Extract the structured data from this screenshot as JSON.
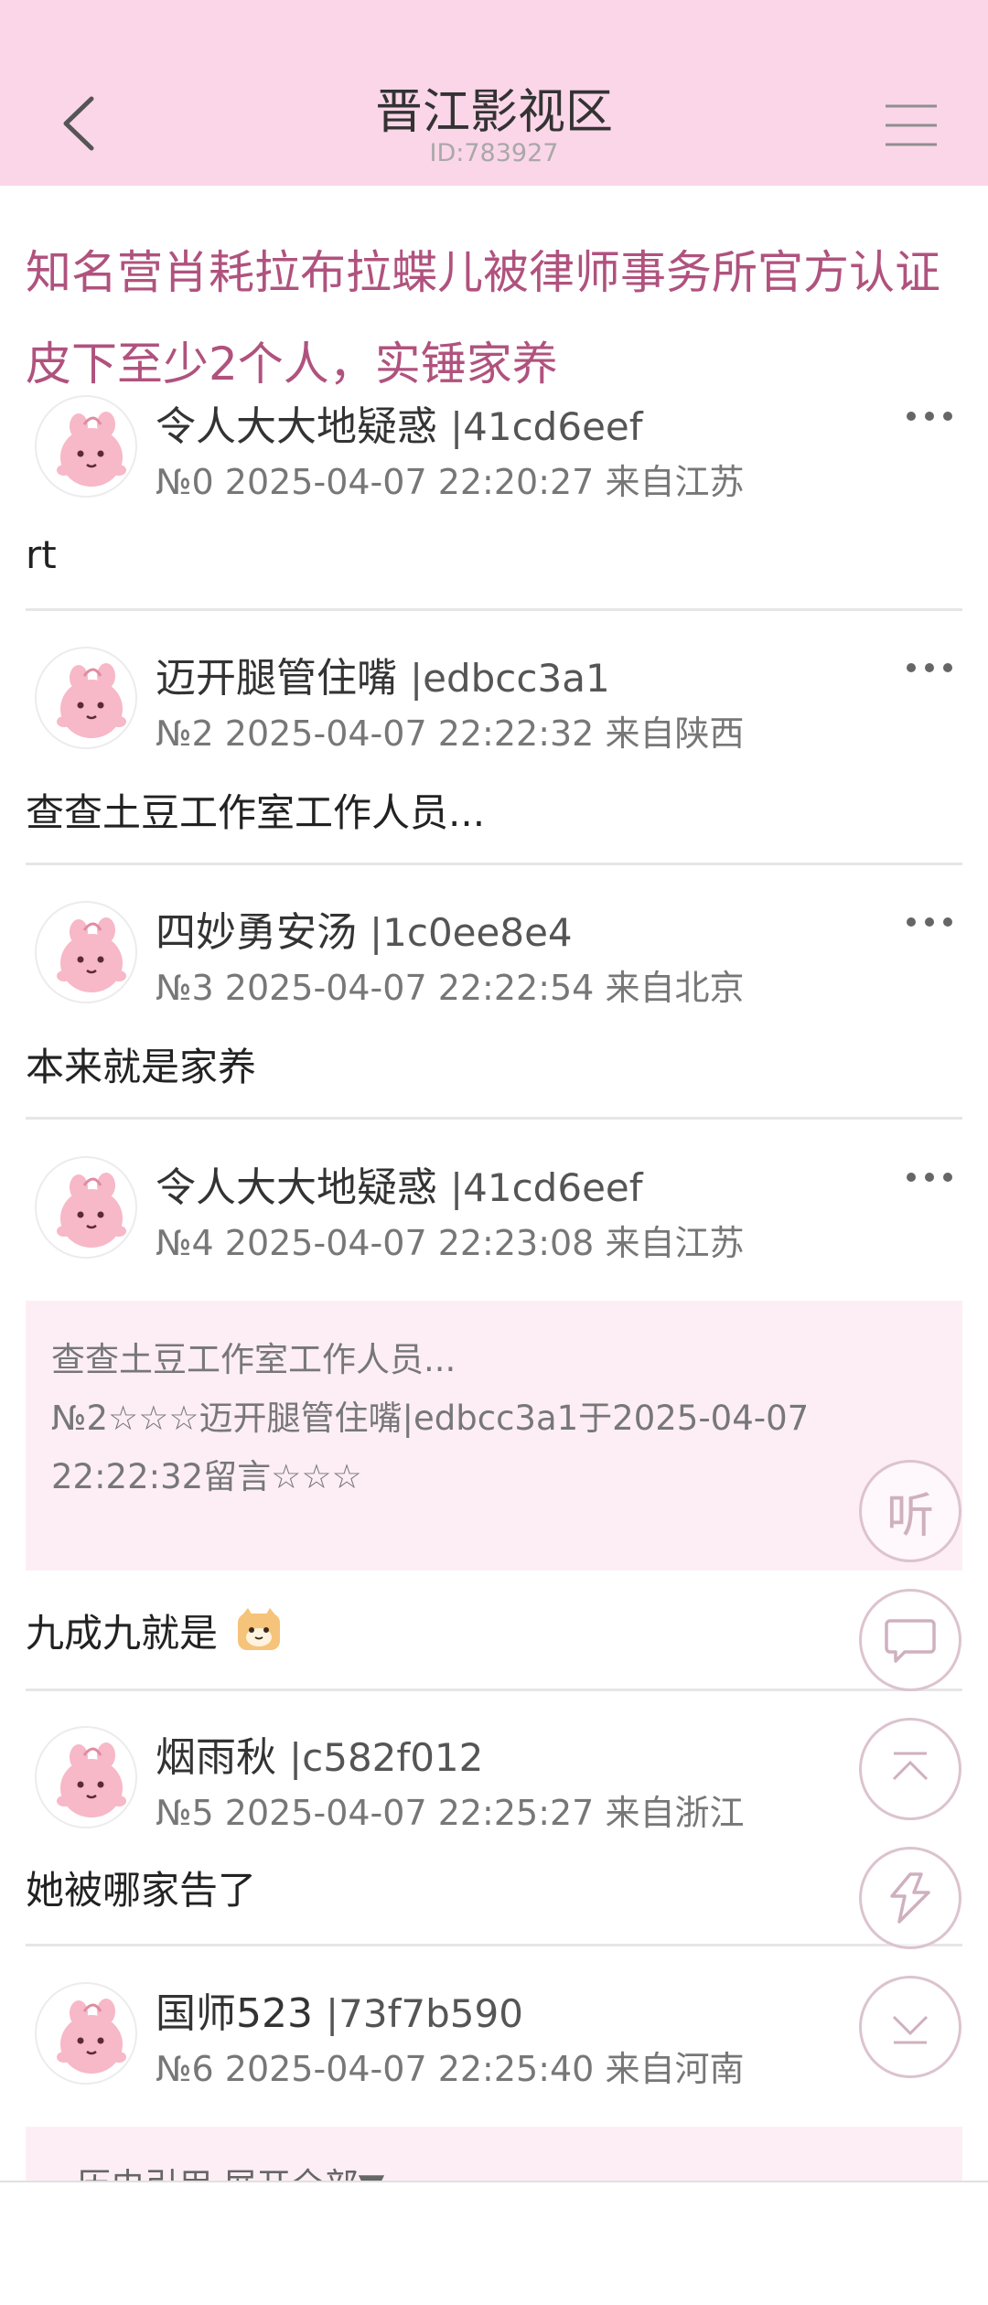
{
  "header": {
    "title": "晋江影视区",
    "board_id": "ID:783927",
    "back_icon": "chevron-left-icon",
    "menu_icon": "hamburger-icon",
    "bg_color": "#fbd6e8"
  },
  "thread": {
    "title_line1": "知名营肖耗拉布拉蝶儿被律师事务所官方认证",
    "title_line2": "皮下至少2个人，实锤家养",
    "title_color": "#b0527e"
  },
  "posts": [
    {
      "name": "令人大大地疑惑",
      "uid": "|41cd6eef",
      "meta": "№0 2025-04-07 22:20:27 来自江苏",
      "content": "rt"
    },
    {
      "name": "迈开腿管住嘴",
      "uid": "|edbcc3a1",
      "meta": "№2 2025-04-07 22:22:32 来自陕西",
      "content": "查查土豆工作室工作人员..."
    },
    {
      "name": "四妙勇安汤",
      "uid": "|1c0ee8e4",
      "meta": "№3 2025-04-07 22:22:54 来自北京",
      "content": "本来就是家养"
    },
    {
      "name": "令人大大地疑惑",
      "uid": "|41cd6eef",
      "meta": "№4 2025-04-07 22:23:08 来自江苏",
      "content": "九成九就是"
    },
    {
      "name": "烟雨秋",
      "uid": "|c582f012",
      "meta": "№5 2025-04-07 22:25:27 来自浙江",
      "content": "她被哪家告了"
    },
    {
      "name": "国师523",
      "uid": "|73f7b590",
      "meta": "№6 2025-04-07 22:25:40 来自河南",
      "content": ""
    }
  ],
  "quote": {
    "line1": "查查土豆工作室工作人员...",
    "line2": "№2☆☆☆迈开腿管住嘴|edbcc3a1于2025-04-07",
    "line3": "22:22:32留言☆☆☆"
  },
  "history_quote": {
    "label": "历史引用 展开全部▼"
  },
  "fabs": {
    "listen_label": "听",
    "comment_icon": "speech-bubble-icon",
    "top_icon": "arrow-up-icon",
    "refresh_icon": "refresh-icon",
    "bottom_icon": "arrow-down-icon"
  },
  "emoji": {
    "name": "cat-face-emoji"
  }
}
